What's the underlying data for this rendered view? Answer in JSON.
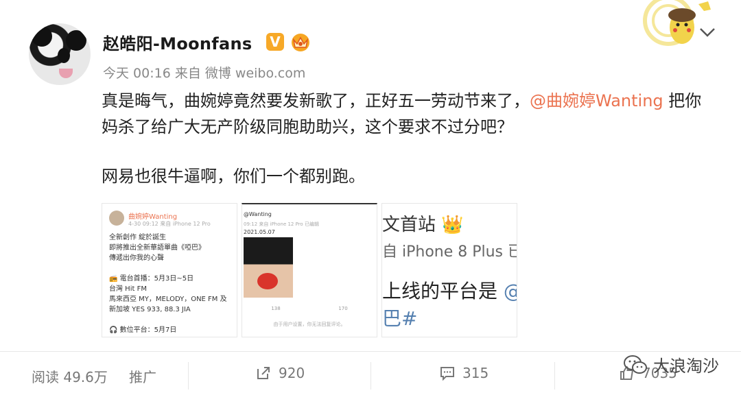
{
  "post": {
    "author": "赵皓阳-Moonfans",
    "badge_v": "V",
    "meta": "今天 00:16 来自 微博 weibo.com",
    "text_part1": "真是晦气，曲婉婷竟然要发新歌了，正好五一劳动节来了，",
    "mention": "@曲婉婷Wanting",
    "text_part2": " 把你妈杀了给广大无产阶级同胞助助兴，这个要求不过分吧？",
    "text_para2": "网易也很牛逼啊，你们一个都别跑。"
  },
  "thumbs": {
    "t1": {
      "name": "曲婉婷Wanting",
      "meta": "4-30 09:12 来自 iPhone 12 Pro",
      "lines": [
        "全新創作 綻於誕生",
        "即將推出全新華語單曲《啞巴》",
        "傳遞出你我的心聲",
        "",
        "📻 電台首播：5月3日~5日",
        "台灣 Hit FM",
        "馬來西亞 MY，MELODY，ONE FM 及",
        "新加坡 YES 933, 88.3 JIA",
        "",
        "🎧 數位平台：5月7日"
      ]
    },
    "t2": {
      "hdr": "@Wanting",
      "hdr2": "09:12 来自 iPhone 12 Pro 已编辑",
      "date": "2021.05.07",
      "count_left": "138",
      "count_right": "170",
      "notice": "由于用户设置，你无法回复评论。"
    },
    "t3": {
      "row1": "文首站",
      "row2": "自 iPhone 8 Plus  已",
      "row3": "上线的平台是 ",
      "row3_at": "@",
      "row4": "巴#"
    }
  },
  "footer": {
    "reads": "阅读 49.6万",
    "promo": "推广",
    "reposts": "920",
    "comments": "315",
    "likes": "7035"
  },
  "watermark": "大浪淘沙",
  "colors": {
    "mention": "#eb7350",
    "badge": "#f7a928",
    "link": "#5580b0"
  }
}
